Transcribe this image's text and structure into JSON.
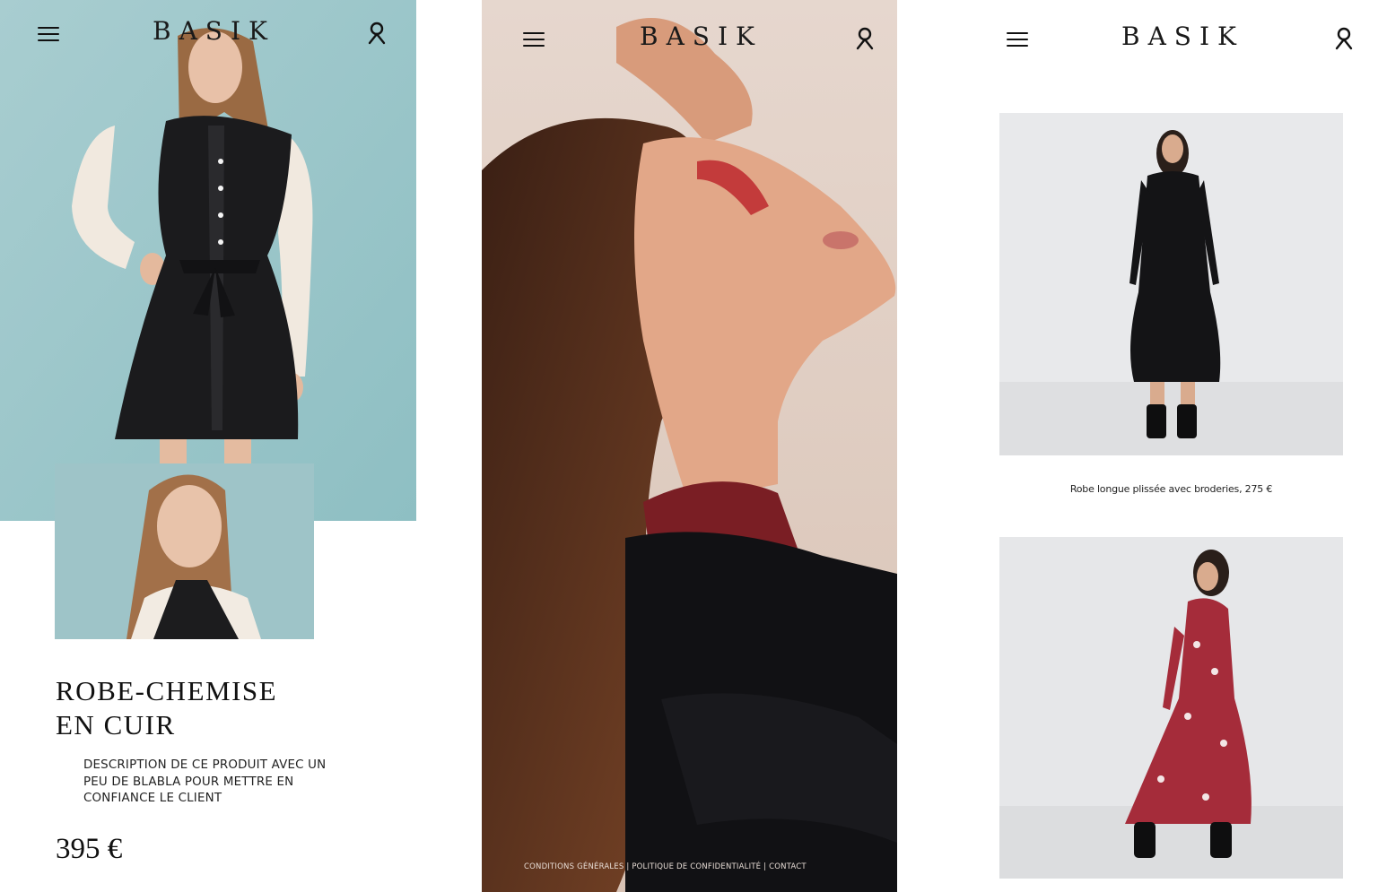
{
  "brand": {
    "logo": "BASIK"
  },
  "screen1": {
    "product_title_line1": "ROBE-CHEMISE",
    "product_title_line2": "EN CUIR",
    "description": "DESCRIPTION DE CE PRODUIT AVEC UN PEU DE BLABLA POUR METTRE EN CONFIANCE LE CLIENT",
    "price": "395 €"
  },
  "screen2": {
    "footer_links": "CONDITIONS GÉNÉRALES | POLITIQUE DE CONFIDENTIALITÉ | CONTACT"
  },
  "screen3": {
    "product1_caption": "Robe longue plissée avec broderies, 275 €"
  },
  "icons": [
    "menu-icon",
    "user-icon"
  ],
  "colors": {
    "teal_background": "#9ec4c8",
    "studio_grey": "#e9eaec",
    "beige_background": "#e2d2c8",
    "text": "#111111"
  }
}
